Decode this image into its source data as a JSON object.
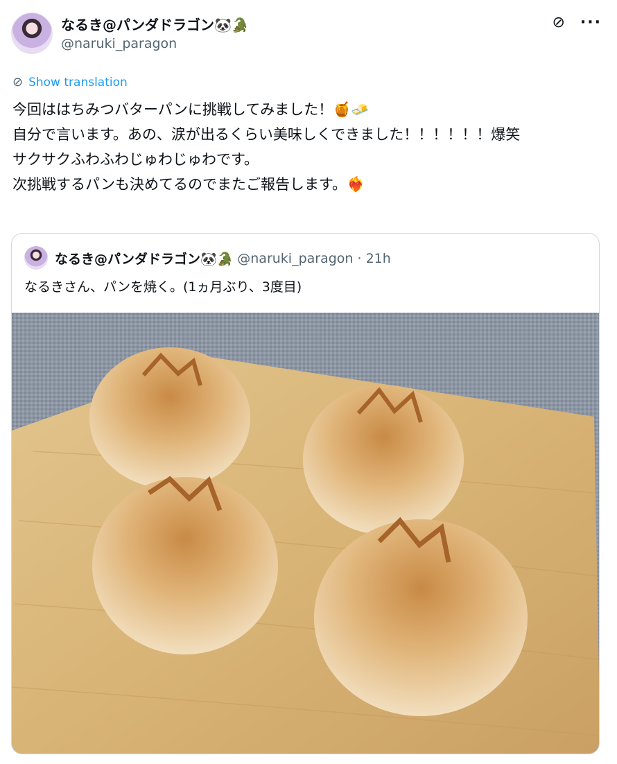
{
  "post": {
    "display_name": "なるき@パンダドラゴン🐼🐊",
    "handle": "@naruki_paragon",
    "show_translation": "Show translation",
    "text": "今回ははちみつバターパンに挑戦してみました！🍯🧈\n自分で言います。あの、涙が出るくらい美味しくできました！！！！！！爆笑\nサクサクふわふわじゅわじゅわです。\n次挑戦するパンも決めてるのでまたご報告します。❤️‍🔥"
  },
  "quote": {
    "display_name": "なるき@パンダドラゴン🐼🐊",
    "handle": "@naruki_paragon",
    "time": "· 21h",
    "text": "なるきさん、パンを焼く。(1ヵ月ぶり、3度目)"
  },
  "icons": {
    "grok": "grok-icon",
    "more": "more-icon",
    "translate": "globe-icon"
  },
  "colors": {
    "link": "#1d9bf0",
    "secondary": "#536471",
    "border": "#cfd9de"
  }
}
